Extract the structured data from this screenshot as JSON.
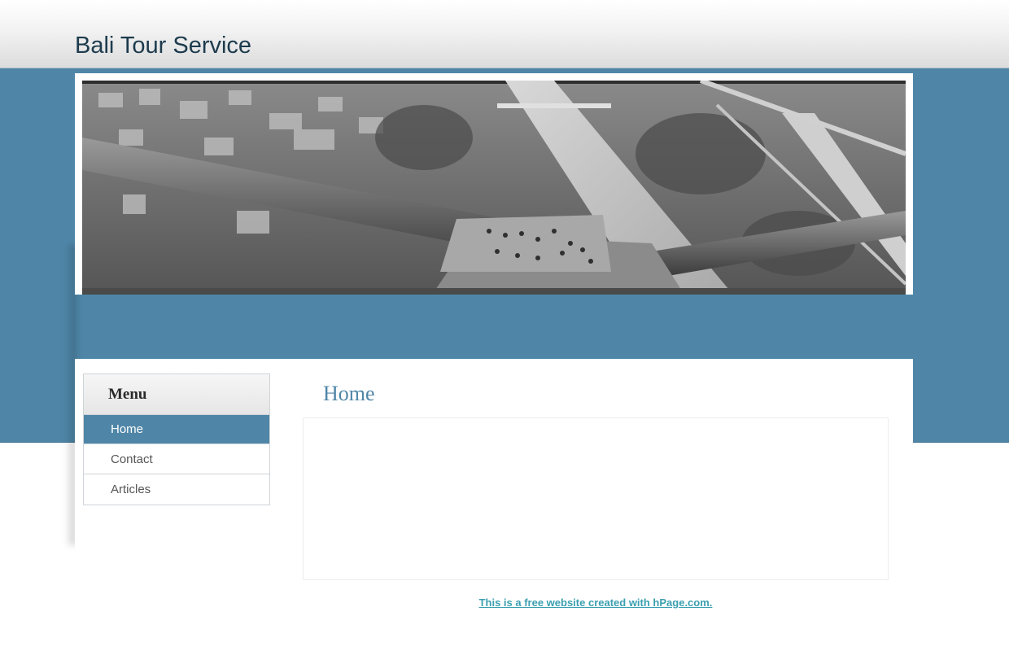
{
  "site": {
    "title": "Bali Tour Service"
  },
  "banner": {
    "image": "aerial-canal-bridge-grayscale-photo"
  },
  "menu": {
    "title": "Menu",
    "items": [
      {
        "label": "Home",
        "active": true
      },
      {
        "label": "Contact",
        "active": false
      },
      {
        "label": "Articles",
        "active": false
      }
    ]
  },
  "main": {
    "heading": "Home"
  },
  "footer": {
    "link_text": "This is a free website created with hPage.com."
  },
  "colors": {
    "accent": "#4f86a8",
    "title": "#1d3b4d",
    "link": "#3a9fb0"
  }
}
